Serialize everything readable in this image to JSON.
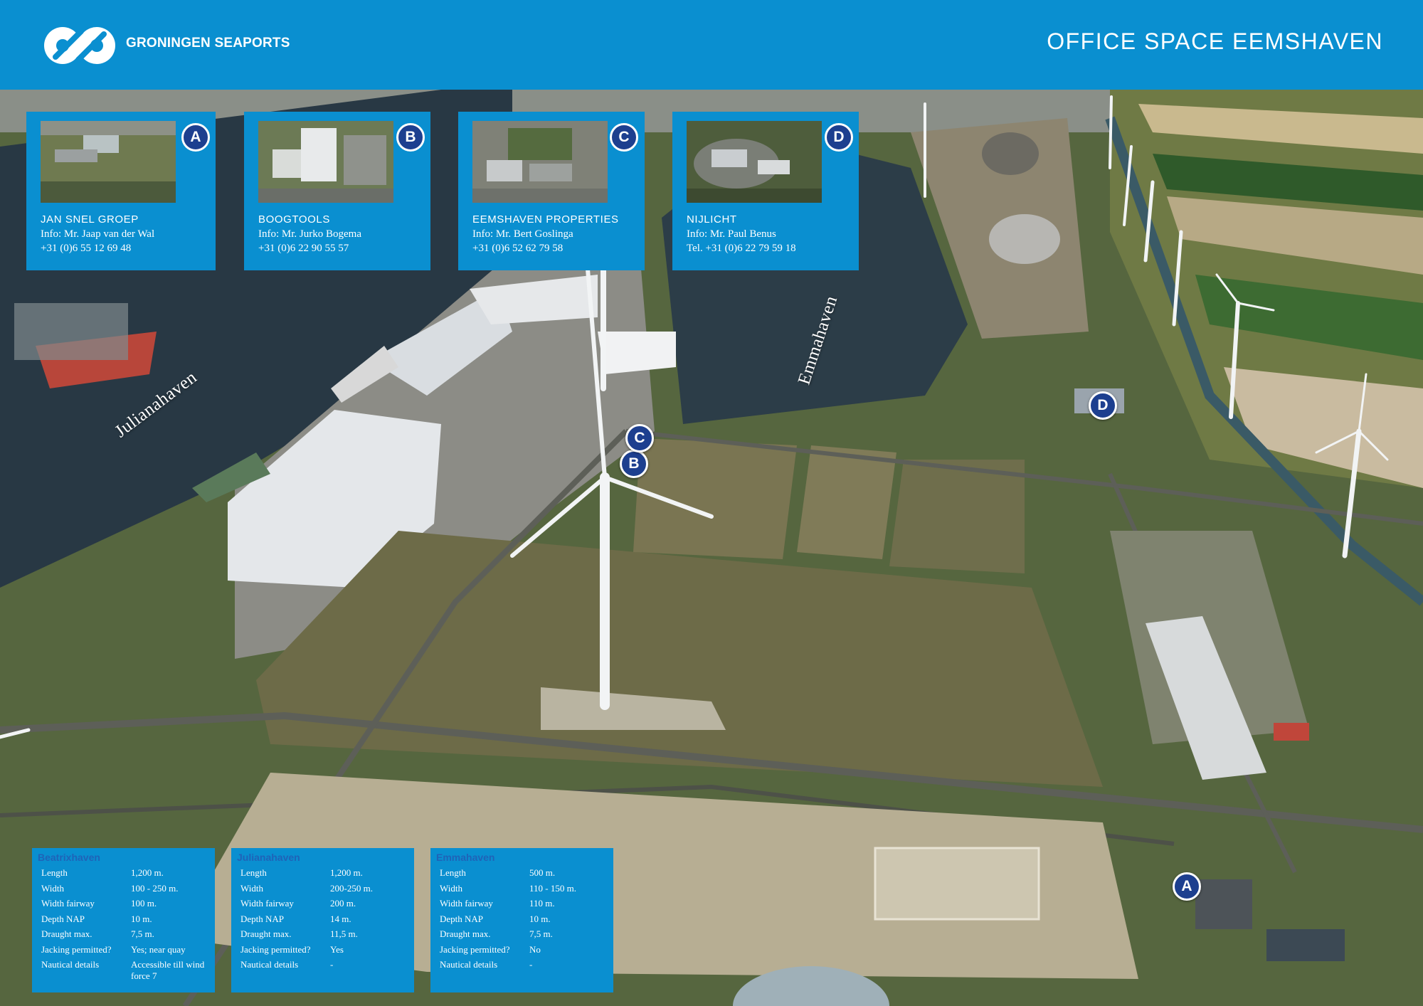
{
  "header": {
    "brand": "GRONINGEN SEAPORTS",
    "title": "OFFICE SPACE EEMSHAVEN",
    "colors": {
      "header_blue": "#0a8fd0",
      "marker_navy": "#1d3f8f"
    }
  },
  "map": {
    "water_labels": [
      "Julianahaven",
      "Emmahaven"
    ],
    "markers": [
      {
        "letter": "A"
      },
      {
        "letter": "B"
      },
      {
        "letter": "C"
      },
      {
        "letter": "D"
      }
    ]
  },
  "companies": [
    {
      "letter": "A",
      "name": "JAN SNEL GROEP",
      "contact": "Info: Mr. Jaap van der Wal",
      "phone": "+31 (0)6 55 12 69 48"
    },
    {
      "letter": "B",
      "name": "BOOGTOOLS",
      "contact": "Info: Mr. Jurko Bogema",
      "phone": "+31 (0)6 22 90 55 57"
    },
    {
      "letter": "C",
      "name": "EEMSHAVEN PROPERTIES",
      "contact": "Info: Mr. Bert Goslinga",
      "phone": "+31 (0)6 52 62 79 58"
    },
    {
      "letter": "D",
      "name": "NIJLICHT",
      "contact": "Info: Mr. Paul Benus",
      "phone": "Tel. +31 (0)6 22 79 59 18"
    }
  ],
  "harbours": [
    {
      "name": "Beatrixhaven",
      "rows": [
        {
          "label": "Length",
          "value": "1,200 m."
        },
        {
          "label": "Width",
          "value": "100 - 250 m."
        },
        {
          "label": "Width fairway",
          "value": "100 m."
        },
        {
          "label": "Depth NAP",
          "value": "10 m."
        },
        {
          "label": "Draught max.",
          "value": "7,5 m."
        },
        {
          "label": "Jacking permitted?",
          "value": "Yes; near quay"
        },
        {
          "label": "Nautical details",
          "value": "Accessible till wind force 7"
        }
      ]
    },
    {
      "name": "Julianahaven",
      "rows": [
        {
          "label": "Length",
          "value": "1,200 m."
        },
        {
          "label": "Width",
          "value": "200-250 m."
        },
        {
          "label": "Width fairway",
          "value": "200 m."
        },
        {
          "label": "Depth NAP",
          "value": "14 m."
        },
        {
          "label": "Draught max.",
          "value": "11,5 m."
        },
        {
          "label": "Jacking permitted?",
          "value": "Yes"
        },
        {
          "label": "Nautical details",
          "value": "-"
        }
      ]
    },
    {
      "name": "Emmahaven",
      "rows": [
        {
          "label": "Length",
          "value": "500 m."
        },
        {
          "label": "Width",
          "value": "110 - 150 m."
        },
        {
          "label": "Width fairway",
          "value": "110 m."
        },
        {
          "label": "Depth NAP",
          "value": "10 m."
        },
        {
          "label": "Draught max.",
          "value": "7,5 m."
        },
        {
          "label": "Jacking permitted?",
          "value": "No"
        },
        {
          "label": "Nautical details",
          "value": "-"
        }
      ]
    }
  ]
}
